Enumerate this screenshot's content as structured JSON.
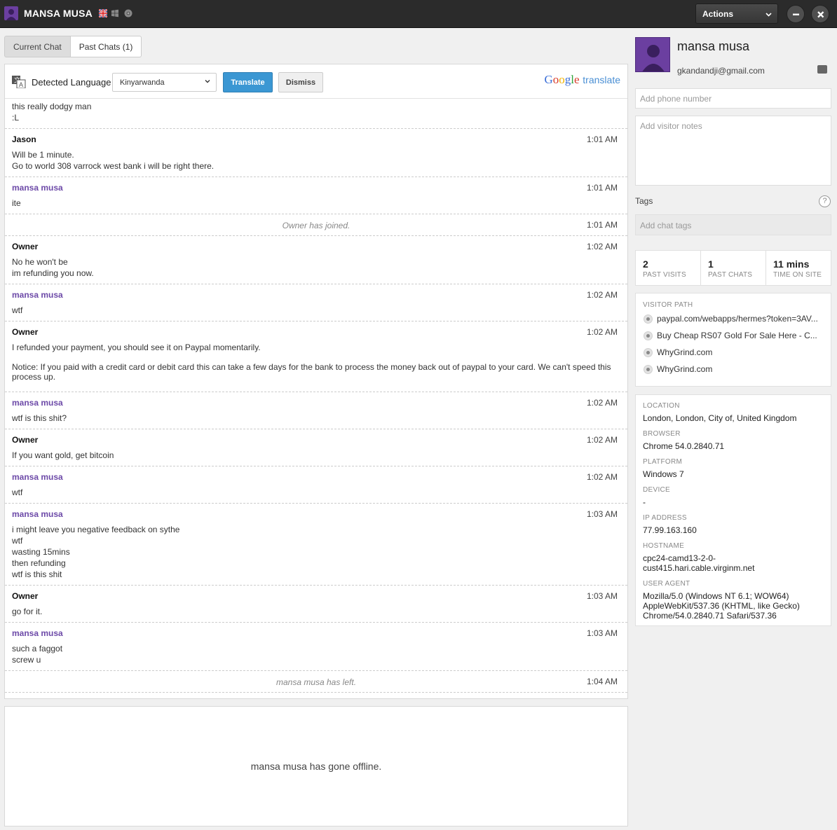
{
  "header": {
    "title": "MANSA MUSA",
    "actions_label": "Actions",
    "minimize_icon": "minus-icon",
    "close_icon": "close-icon"
  },
  "tabs": [
    {
      "label": "Current Chat"
    },
    {
      "label": "Past Chats (1)"
    }
  ],
  "translate": {
    "detected_label": "Detected Language",
    "language": "Kinyarwanda",
    "translate_button": "Translate",
    "dismiss_button": "Dismiss",
    "brand_google": "Google",
    "brand_translate": "translate"
  },
  "messages": [
    {
      "type": "continuation",
      "lines": [
        "this really dodgy man",
        ":L"
      ]
    },
    {
      "type": "agent",
      "sender": "Jason",
      "time": "1:01 AM",
      "lines": [
        "Will be 1 minute.",
        "Go to world 308 varrock west bank i will be right there."
      ]
    },
    {
      "type": "visitor",
      "sender": "mansa musa",
      "time": "1:01 AM",
      "lines": [
        "ite"
      ]
    },
    {
      "type": "system",
      "text": "Owner has joined.",
      "time": "1:01 AM"
    },
    {
      "type": "agent",
      "sender": "Owner",
      "time": "1:02 AM",
      "lines": [
        "No he won't be",
        "im refunding you now."
      ]
    },
    {
      "type": "visitor",
      "sender": "mansa musa",
      "time": "1:02 AM",
      "lines": [
        "wtf"
      ]
    },
    {
      "type": "agent",
      "sender": "Owner",
      "time": "1:02 AM",
      "lines": [
        "I refunded your payment, you should see it on Paypal momentarily.",
        "",
        "Notice: If you paid with a credit card or debit card this can take a few days for the bank to process the money back out of paypal to your card. We can't speed this",
        "process up."
      ]
    },
    {
      "type": "visitor",
      "sender": "mansa musa",
      "time": "1:02 AM",
      "lines": [
        "wtf is this shit?"
      ]
    },
    {
      "type": "agent",
      "sender": "Owner",
      "time": "1:02 AM",
      "lines": [
        "If you want gold, get bitcoin"
      ]
    },
    {
      "type": "visitor",
      "sender": "mansa musa",
      "time": "1:02 AM",
      "lines": [
        "wtf"
      ]
    },
    {
      "type": "visitor",
      "sender": "mansa musa",
      "time": "1:03 AM",
      "lines": [
        "i might leave you negative feedback on sythe",
        "wtf",
        "wasting 15mins",
        "then refunding",
        "wtf is this shit"
      ]
    },
    {
      "type": "agent",
      "sender": "Owner",
      "time": "1:03 AM",
      "lines": [
        "go for it."
      ]
    },
    {
      "type": "visitor",
      "sender": "mansa musa",
      "time": "1:03 AM",
      "lines": [
        "such a faggot",
        "screw u"
      ]
    },
    {
      "type": "system",
      "text": "mansa musa has left.",
      "time": "1:04 AM"
    }
  ],
  "offline_text": "mansa musa has gone offline.",
  "visitor": {
    "name": "mansa musa",
    "email": "gkandandji@gmail.com",
    "phone_placeholder": "Add phone number",
    "notes_placeholder": "Add visitor notes",
    "tags_label": "Tags",
    "help_glyph": "?",
    "tags_placeholder": "Add chat tags"
  },
  "stats": [
    {
      "value": "2",
      "caption": "PAST VISITS"
    },
    {
      "value": "1",
      "caption": "PAST CHATS"
    },
    {
      "value": "11 mins",
      "caption": "TIME ON SITE"
    }
  ],
  "visitor_path": {
    "caption": "VISITOR PATH",
    "items": [
      "paypal.com/webapps/hermes?token=3AV...",
      "Buy Cheap RS07 Gold For Sale Here - C...",
      "WhyGrind.com",
      "WhyGrind.com"
    ]
  },
  "info": [
    {
      "caption": "LOCATION",
      "value": "London, London, City of, United Kingdom"
    },
    {
      "caption": "BROWSER",
      "value": "Chrome 54.0.2840.71"
    },
    {
      "caption": "PLATFORM",
      "value": "Windows 7"
    },
    {
      "caption": "DEVICE",
      "value": "-"
    },
    {
      "caption": "IP ADDRESS",
      "value": "77.99.163.160"
    },
    {
      "caption": "HOSTNAME",
      "value": "cpc24-camd13-2-0-\ncust415.hari.cable.virginm.net"
    },
    {
      "caption": "USER AGENT",
      "value": "Mozilla/5.0 (Windows NT 6.1; WOW64)\nAppleWebKit/537.36 (KHTML, like Gecko)\nChrome/54.0.2840.71 Safari/537.36"
    }
  ],
  "colors": {
    "accent_blue": "#3b97d3",
    "visitor_name": "#6d4aa8",
    "avatar": "#6b3fa0",
    "topbar": "#2b2b2b"
  }
}
